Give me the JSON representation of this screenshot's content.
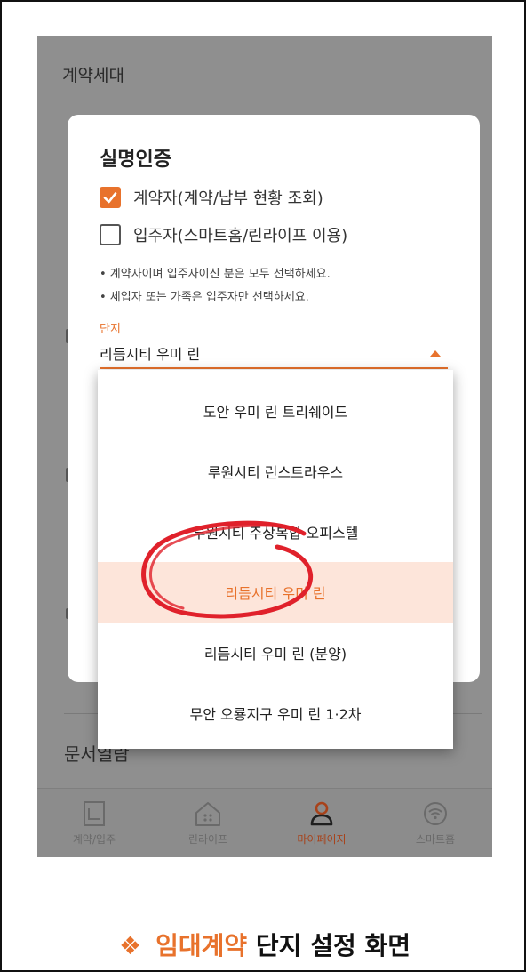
{
  "background": {
    "section_title": "계약세대",
    "doc_label": "문서열람"
  },
  "modal": {
    "title": "실명인증",
    "options": [
      {
        "label": "계약자(계약/납부 현황 조회)",
        "checked": true
      },
      {
        "label": "입주자(스마트홈/린라이프 이용)",
        "checked": false
      }
    ],
    "notes": [
      "• 계약자이며 입주자이신 분은 모두 선택하세요.",
      "• 세입자 또는 가족은 입주자만 선택하세요."
    ],
    "field": {
      "label": "단지",
      "value": "리듬시티 우미 린"
    }
  },
  "dropdown": {
    "items": [
      "도안 우미 린 트리쉐이드",
      "루원시티 린스트라우스",
      "루원시티 주상복합 오피스텔",
      "리듬시티 우미 린",
      "리듬시티 우미 린 (분양)",
      "무안 오룡지구 우미 린 1·2차"
    ],
    "selected_index": 3
  },
  "bottom_nav": [
    {
      "label": "계약/입주",
      "icon": "document-icon",
      "active": false
    },
    {
      "label": "린라이프",
      "icon": "house-icon",
      "active": false
    },
    {
      "label": "마이페이지",
      "icon": "person-icon",
      "active": true
    },
    {
      "label": "스마트홈",
      "icon": "wifi-icon",
      "active": false
    }
  ],
  "caption": {
    "bullet": "❖",
    "accent": "임대계약",
    "rest": " 단지 설정 화면"
  },
  "colors": {
    "accent": "#e8722c",
    "selected_bg": "#fde5da",
    "overlay": "#8f8f8f",
    "annotation_red": "#e0212b"
  }
}
